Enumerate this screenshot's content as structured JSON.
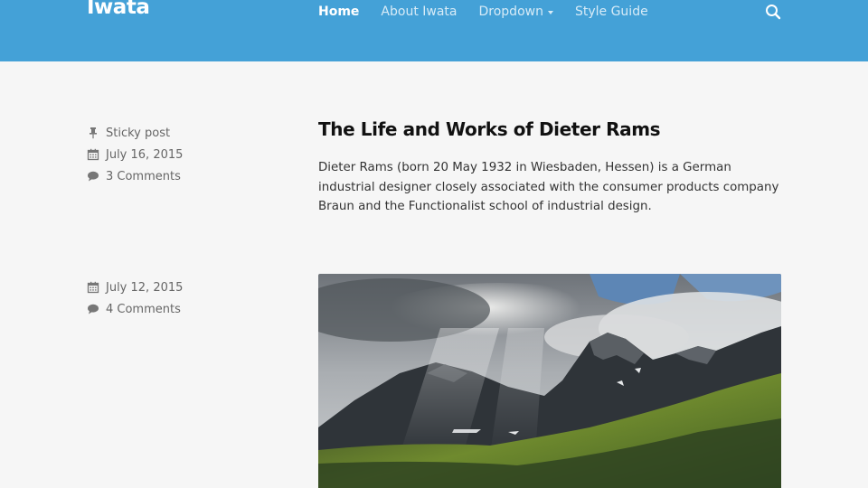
{
  "site": {
    "brand": "Iwata"
  },
  "nav": {
    "items": [
      {
        "label": "Home",
        "active": true
      },
      {
        "label": "About Iwata",
        "active": false
      },
      {
        "label": "Dropdown",
        "active": false,
        "has_caret": true
      },
      {
        "label": "Style Guide",
        "active": false
      }
    ],
    "search_icon": "search-icon"
  },
  "posts": [
    {
      "sticky_label": "Sticky post",
      "date": "July 16, 2015",
      "comments": "3 Comments",
      "title": "The Life and Works of Dieter Rams",
      "excerpt": "Dieter Rams (born 20 May 1932 in Wiesbaden, Hessen) is a German industrial designer closely associated with the consumer products company Braun and the Functionalist school of industrial design."
    },
    {
      "date": "July 12, 2015",
      "comments": "4 Comments",
      "image": "mountain-landscape-photo"
    }
  ],
  "colors": {
    "header": "#44a1d7",
    "background": "#f6f6f6",
    "meta_text": "#666666"
  }
}
